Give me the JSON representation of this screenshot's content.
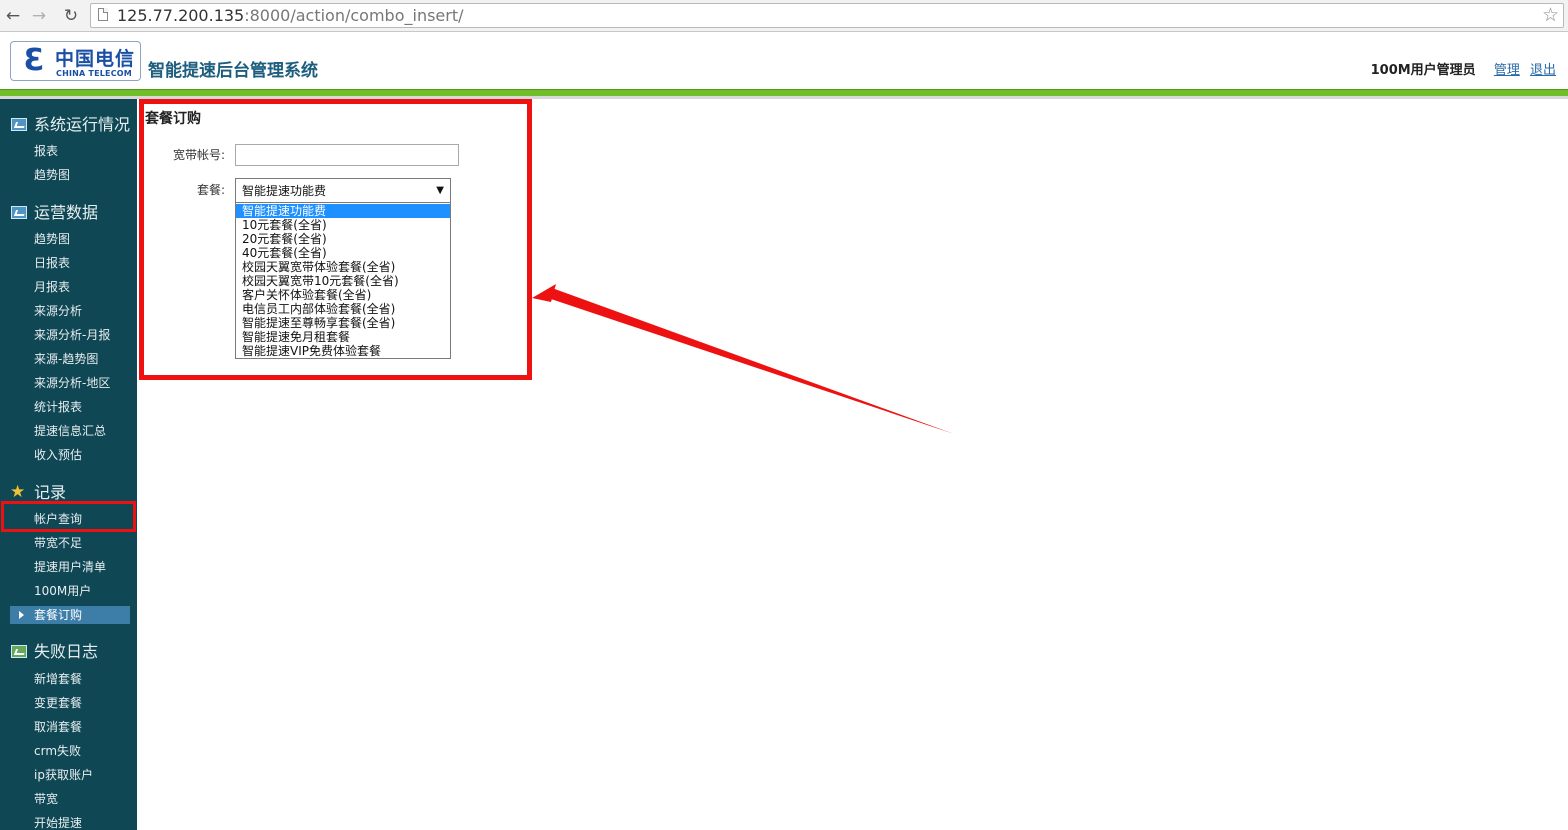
{
  "browser": {
    "url_host": "125.77.200.135",
    "url_rest": ":8000/action/combo_insert/"
  },
  "header": {
    "logo_cn": "中国电信",
    "logo_en": "CHINA TELECOM",
    "system_title": "智能提速后台管理系统",
    "user_name": "100M用户管理员",
    "manage_link": "管理",
    "logout_link": "退出"
  },
  "sidebar": {
    "sections": [
      {
        "title": "系统运行情况",
        "icon": "monitor-chart-icon",
        "items": [
          "报表",
          "趋势图"
        ]
      },
      {
        "title": "运营数据",
        "icon": "monitor-chart-icon",
        "items": [
          "趋势图",
          "日报表",
          "月报表",
          "来源分析",
          "来源分析-月报",
          "来源-趋势图",
          "来源分析-地区",
          "统计报表",
          "提速信息汇总",
          "收入预估"
        ]
      },
      {
        "title": "记录",
        "icon": "star-icon",
        "items": [
          "帐户查询",
          "带宽不足",
          "提速用户清单",
          "100M用户",
          "套餐订购"
        ]
      },
      {
        "title": "失败日志",
        "icon": "picture-icon",
        "items": [
          "新增套餐",
          "变更套餐",
          "取消套餐",
          "crm失败",
          "ip获取账户",
          "带宽",
          "开始提速"
        ]
      }
    ],
    "active_item": "套餐订购"
  },
  "form": {
    "title": "套餐订购",
    "account_label": "宽带帐号:",
    "account_value": "",
    "combo_label": "套餐:",
    "combo_selected": "智能提速功能费",
    "combo_options": [
      "智能提速功能费",
      "10元套餐(全省)",
      "20元套餐(全省)",
      "40元套餐(全省)",
      "校园天翼宽带体验套餐(全省)",
      "校园天翼宽带10元套餐(全省)",
      "客户关怀体验套餐(全省)",
      "电信员工内部体验套餐(全省)",
      "智能提速至尊畅享套餐(全省)",
      "智能提速免月租套餐",
      "智能提速VIP免费体验套餐"
    ]
  },
  "colors": {
    "sidebar_bg": "#0f4754",
    "header_green": "#6fbe2a",
    "highlight_red": "#ee1111",
    "option_selected": "#1e90ff"
  }
}
